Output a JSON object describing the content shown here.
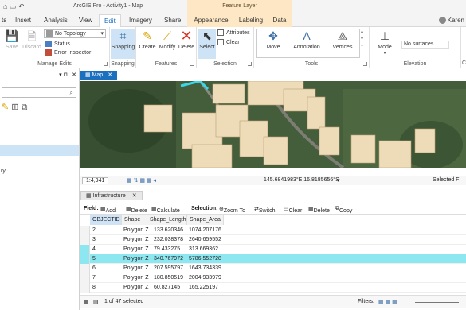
{
  "app": {
    "title": "ArcGIS Pro - Activity1 - Map",
    "contextual_tab_group": "Feature Layer",
    "user": "Karen"
  },
  "tabs": [
    "ts",
    "Insert",
    "Analysis",
    "View",
    "Edit",
    "Imagery",
    "Share",
    "Appearance",
    "Labeling",
    "Data"
  ],
  "ribbon": {
    "manage_edits": {
      "label": "Manage Edits",
      "save": "Save",
      "discard": "Discard",
      "topology": "No Topology",
      "status": "Status",
      "error_inspector": "Error Inspector"
    },
    "snapping": {
      "label": "Snapping",
      "button": "Snapping"
    },
    "features": {
      "label": "Features",
      "create": "Create",
      "modify": "Modify",
      "delete": "Delete"
    },
    "selection": {
      "label": "Selection",
      "select": "Select",
      "attributes": "Attributes",
      "clear": "Clear"
    },
    "tools": {
      "label": "Tools",
      "move": "Move",
      "annotation": "Annotation",
      "vertices": "Vertices"
    },
    "elevation": {
      "label": "Elevation",
      "mode": "Mode",
      "surface_placeholder": "No surfaces"
    },
    "partial_label": "C"
  },
  "left_panel": {
    "fragment": "ry"
  },
  "map": {
    "tab": "Map",
    "scale": "1:4,941",
    "coordinates": "145.6841983°E 16.8185656°S",
    "selected": "Selected F"
  },
  "table": {
    "tab": "Infrastructure",
    "toolbar": {
      "field_label": "Field:",
      "add": "Add",
      "delete": "Delete",
      "calculate": "Calculate",
      "selection_label": "Selection:",
      "zoom_to": "Zoom To",
      "switch": "Switch",
      "clear": "Clear",
      "delete_sel": "Delete",
      "copy": "Copy"
    },
    "columns": [
      "OBJECTID",
      "Shape",
      "Shape_Length",
      "Shape_Area"
    ],
    "rows": [
      [
        "2",
        "Polygon Z",
        "133.620346",
        "1074.207176"
      ],
      [
        "3",
        "Polygon Z",
        "232.038378",
        "2640.659552"
      ],
      [
        "4",
        "Polygon Z",
        "79.433275",
        "313.669362"
      ],
      [
        "5",
        "Polygon Z",
        "340.767972",
        "5786.552728"
      ],
      [
        "6",
        "Polygon Z",
        "207.595797",
        "1643.734339"
      ],
      [
        "7",
        "Polygon Z",
        "180.850519",
        "2004.933979"
      ],
      [
        "8",
        "Polygon Z",
        "60.827145",
        "165.225197"
      ]
    ],
    "selected_row": 3,
    "status": "1 of 47 selected",
    "filters_label": "Filters:"
  }
}
